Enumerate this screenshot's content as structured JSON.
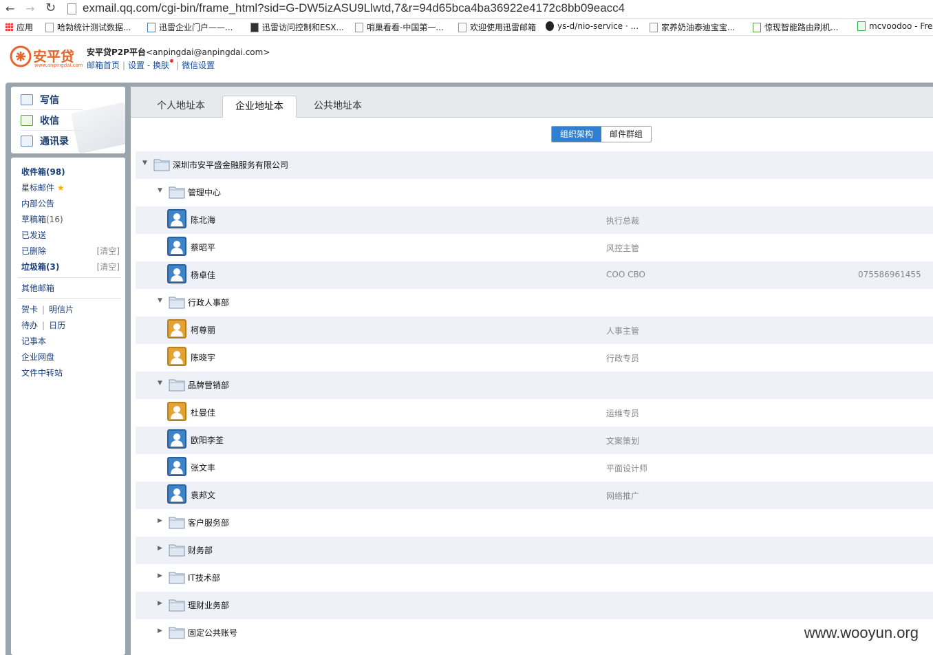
{
  "browser": {
    "url": "exmail.qq.com/cgi-bin/frame_html?sid=G-DW5izASU9Llwtd,7&r=94d65bca4ba36922e4172c8bb09eacc4",
    "bookmarks": [
      "应用",
      "哈勃统计测试数据...",
      "迅雷企业门户——...",
      "迅雷访问控制和ESX...",
      "哨巢看看-中国第一...",
      "欢迎使用迅雷邮箱",
      "ys-d/nio-service · ...",
      "家养奶油泰迪宝宝...",
      "惊现智能路由刷机...",
      "mcvoodoo - Fre"
    ]
  },
  "header": {
    "logo_text": "安平贷",
    "logo_sub": "www.anpingdai.com",
    "account_name": "安平贷P2P平台",
    "account_email": "<anpingdai@anpingdai.com>",
    "links": [
      "邮箱首页",
      "设置",
      "换肤",
      "微信设置"
    ]
  },
  "quick_actions": [
    "写信",
    "收信",
    "通讯录"
  ],
  "folders": {
    "inbox": "收件箱(98)",
    "starred": "星标邮件",
    "notice": "内部公告",
    "drafts": "草稿箱",
    "drafts_count": "(16)",
    "sent": "已发送",
    "deleted": "已删除",
    "spam": "垃圾箱(3)",
    "clear": "[清空]",
    "other": "其他邮箱",
    "card": "贺卡",
    "postcard": "明信片",
    "todo": "待办",
    "calendar": "日历",
    "notes": "记事本",
    "disk": "企业网盘",
    "transfer": "文件中转站"
  },
  "tabs": [
    "个人地址本",
    "企业地址本",
    "公共地址本"
  ],
  "segments": [
    "组织架构",
    "邮件群组"
  ],
  "tree": {
    "company": "深圳市安平盛金融服务有限公司",
    "groups": [
      {
        "name": "管理中心",
        "members": [
          {
            "name": "陈北海",
            "title": "执行总裁",
            "phone": "",
            "avatar": "blue"
          },
          {
            "name": "蔡昭平",
            "title": "风控主管",
            "phone": "",
            "avatar": "blue"
          },
          {
            "name": "杨卓佳",
            "title": "COO CBO",
            "phone": "075586961455",
            "avatar": "blue"
          }
        ]
      },
      {
        "name": "行政人事部",
        "members": [
          {
            "name": "柯尊丽",
            "title": "人事主管",
            "phone": "",
            "avatar": "gold"
          },
          {
            "name": "陈晓宇",
            "title": "行政专员",
            "phone": "",
            "avatar": "gold"
          }
        ]
      },
      {
        "name": "品牌营销部",
        "members": [
          {
            "name": "杜曼佳",
            "title": "运维专员",
            "phone": "",
            "avatar": "gold"
          },
          {
            "name": "欧阳李荃",
            "title": "文案策划",
            "phone": "",
            "avatar": "blue"
          },
          {
            "name": "张文丰",
            "title": "平面设计师",
            "phone": "",
            "avatar": "blue"
          },
          {
            "name": "袁邦文",
            "title": "网络推广",
            "phone": "",
            "avatar": "blue"
          }
        ]
      },
      {
        "name": "客户服务部",
        "members": []
      },
      {
        "name": "财务部",
        "members": []
      },
      {
        "name": "IT技术部",
        "members": []
      },
      {
        "name": "理财业务部",
        "members": []
      },
      {
        "name": "固定公共账号",
        "members": []
      }
    ]
  },
  "watermark": "www.wooyun.org"
}
